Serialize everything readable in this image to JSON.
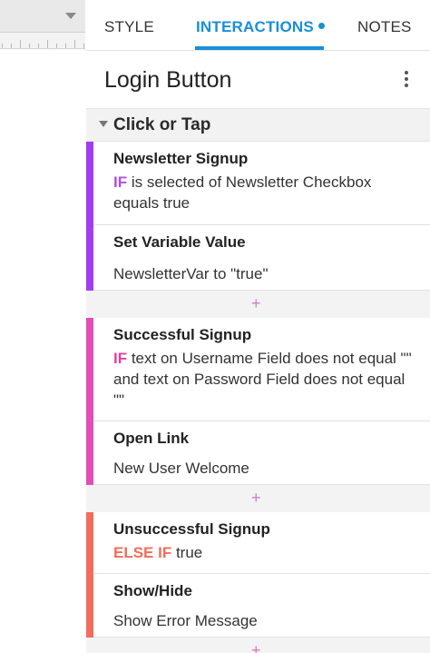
{
  "tabs": {
    "style": "STYLE",
    "interactions": "INTERACTIONS",
    "notes": "NOTES",
    "active": "INTERACTIONS",
    "accent_color": "#1a8fd6"
  },
  "widget": {
    "title": "Login Button",
    "menu_icon": "more-vertical-icon"
  },
  "event": {
    "label": "Click or Tap"
  },
  "cases": [
    {
      "name": "Newsletter Signup",
      "color": "#a33cf0",
      "condition_keyword": "IF",
      "condition_text": " is selected of Newsletter Checkbox equals true",
      "action_title": "Set Variable Value",
      "action_text": "NewsletterVar to \"true\""
    },
    {
      "name": "Successful Signup",
      "color": "#e34db8",
      "condition_keyword": "IF",
      "condition_text": " text on Username Field does not equal \"\" and text on Password Field does not equal \"\"",
      "action_title": "Open Link",
      "action_text": "New User Welcome"
    },
    {
      "name": "Unsuccessful Signup",
      "color": "#f26d5b",
      "condition_keyword": "ELSE IF",
      "condition_text": " true",
      "action_title": "Show/Hide",
      "action_text": "Show Error Message"
    }
  ],
  "add_symbol": "+"
}
